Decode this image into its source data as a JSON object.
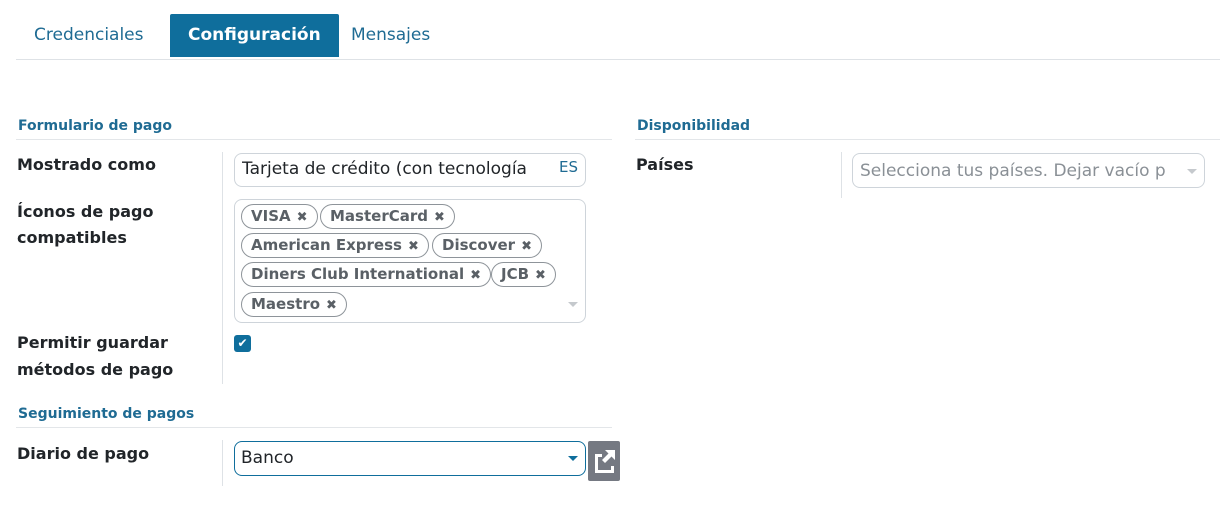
{
  "tabs": [
    {
      "label": "Credenciales"
    },
    {
      "label": "Configuración"
    },
    {
      "label": "Mensajes"
    }
  ],
  "form_section": {
    "title": "Formulario de pago",
    "displayed_as": {
      "label": "Mostrado como",
      "value": "Tarjeta de crédito (con tecnología",
      "lang": "ES"
    },
    "icons": {
      "label_line1": "Íconos de pago",
      "label_line2": "compatibles",
      "tags": [
        "VISA",
        "MasterCard",
        "American Express",
        "Discover",
        "Diners Club International",
        "JCB",
        "Maestro"
      ]
    },
    "save_methods": {
      "label_line1": "Permitir guardar",
      "label_line2": "métodos de pago",
      "checked": true
    }
  },
  "tracking_section": {
    "title": "Seguimiento de pagos",
    "journal": {
      "label": "Diario de pago",
      "value": "Banco"
    }
  },
  "availability_section": {
    "title": "Disponibilidad",
    "countries": {
      "label": "Países",
      "placeholder": "Selecciona tus países. Dejar vacío p"
    }
  },
  "colors": {
    "accent": "#0f6e9c",
    "section_title": "#1f6b93"
  },
  "icons": {
    "remove_tag": "close-icon",
    "dropdown": "caret-down-icon",
    "external_link": "external-link-icon",
    "checkbox": "check-icon"
  }
}
